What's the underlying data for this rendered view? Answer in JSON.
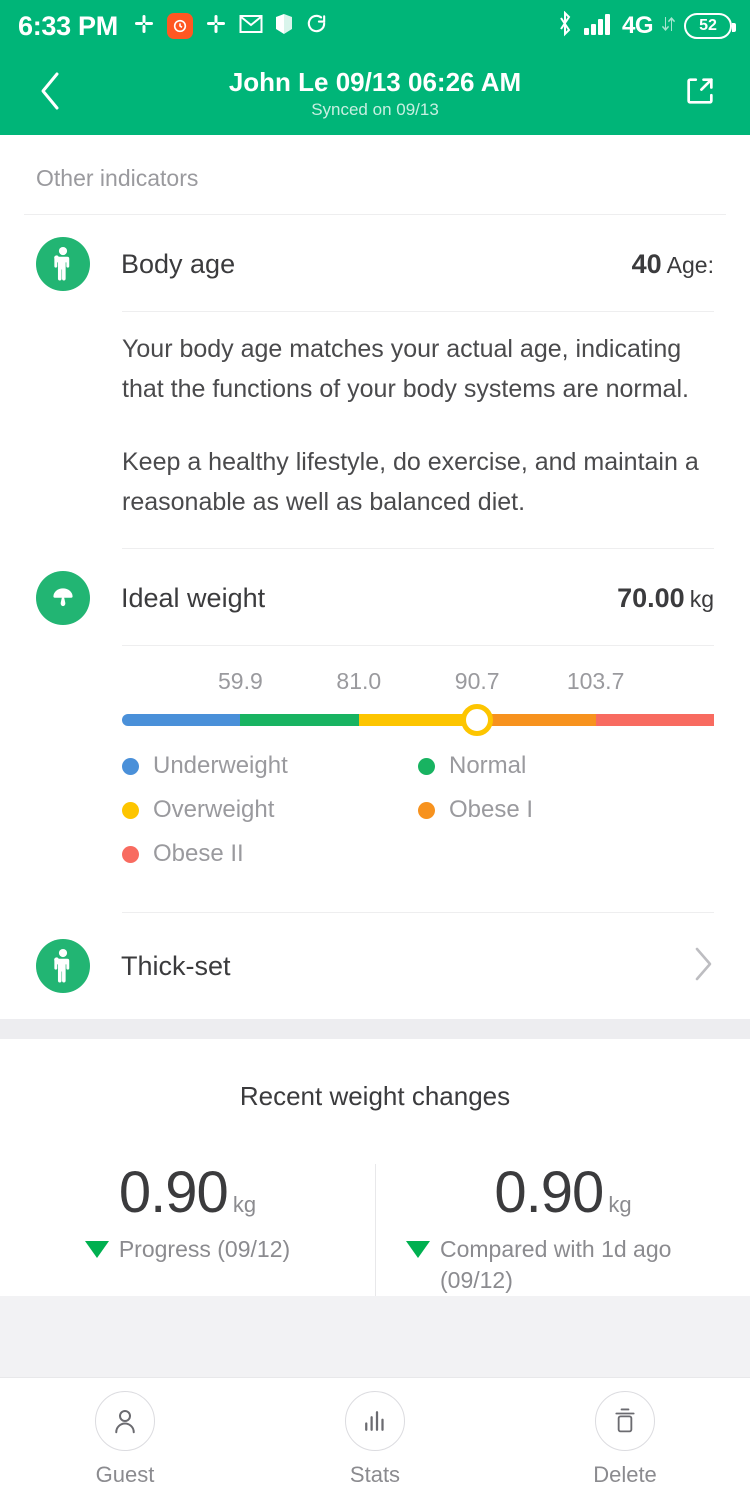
{
  "status_bar": {
    "time": "6:33 PM",
    "battery_percent": "52",
    "network_label": "4G",
    "icons": [
      "slack-icon",
      "app-badge-icon",
      "slack-icon",
      "gmail-icon",
      "book-icon",
      "sync-icon",
      "bluetooth-icon",
      "signal-icon",
      "network-icon",
      "battery-icon"
    ]
  },
  "header": {
    "title": "John Le 09/13 06:26 AM",
    "subtitle": "Synced on 09/13",
    "back_icon": "chevron-left-icon",
    "share_icon": "share-icon"
  },
  "main": {
    "section_title": "Other indicators",
    "body_age": {
      "label": "Body age",
      "value": "40",
      "unit": "Age:",
      "icon": "person-icon",
      "paragraphs": [
        "Your body age matches your actual age, indicating that the functions of your body systems are normal.",
        "Keep a healthy lifestyle, do exercise, and maintain a reasonable as well as balanced diet."
      ]
    },
    "ideal_weight": {
      "label": "Ideal weight",
      "value": "70.00",
      "unit": "kg",
      "icon": "scale-icon",
      "legend": [
        {
          "label": "Underweight",
          "color": "#4a90d9"
        },
        {
          "label": "Normal",
          "color": "#18b361"
        },
        {
          "label": "Overweight",
          "color": "#fdc500"
        },
        {
          "label": "Obese I",
          "color": "#f7921e"
        },
        {
          "label": "Obese II",
          "color": "#f86b60"
        }
      ]
    },
    "body_type": {
      "label": "Thick-set",
      "icon": "person-icon",
      "chevron": "chevron-right-icon"
    }
  },
  "chart_data": {
    "type": "bar",
    "title": "Ideal weight BMI scale",
    "categories": [
      "Underweight",
      "Normal",
      "Overweight",
      "Obese I",
      "Obese II"
    ],
    "colors": [
      "#4a90d9",
      "#18b361",
      "#fdc500",
      "#f7921e",
      "#f86b60"
    ],
    "tick_labels": [
      "59.9",
      "81.0",
      "90.7",
      "103.7"
    ],
    "tick_positions_pct": [
      20,
      40,
      60,
      80
    ],
    "marker_position_pct": 60,
    "marker_value": "70.00",
    "unit": "kg",
    "xlabel": "",
    "ylabel": "",
    "grid": false,
    "legend_position": "below"
  },
  "recent": {
    "title": "Recent weight changes",
    "stats": [
      {
        "value": "0.90",
        "unit": "kg",
        "caption": "Progress (09/12)",
        "direction": "down",
        "direction_color": "#00b050"
      },
      {
        "value": "0.90",
        "unit": "kg",
        "caption": "Compared with 1d ago (09/12)",
        "direction": "down",
        "direction_color": "#00b050"
      }
    ]
  },
  "bottom_bar": {
    "items": [
      {
        "label": "Guest",
        "icon": "user-icon"
      },
      {
        "label": "Stats",
        "icon": "bar-chart-icon"
      },
      {
        "label": "Delete",
        "icon": "trash-icon"
      }
    ]
  },
  "theme": {
    "brand_green": "#00b578",
    "icon_green": "#22b573"
  }
}
